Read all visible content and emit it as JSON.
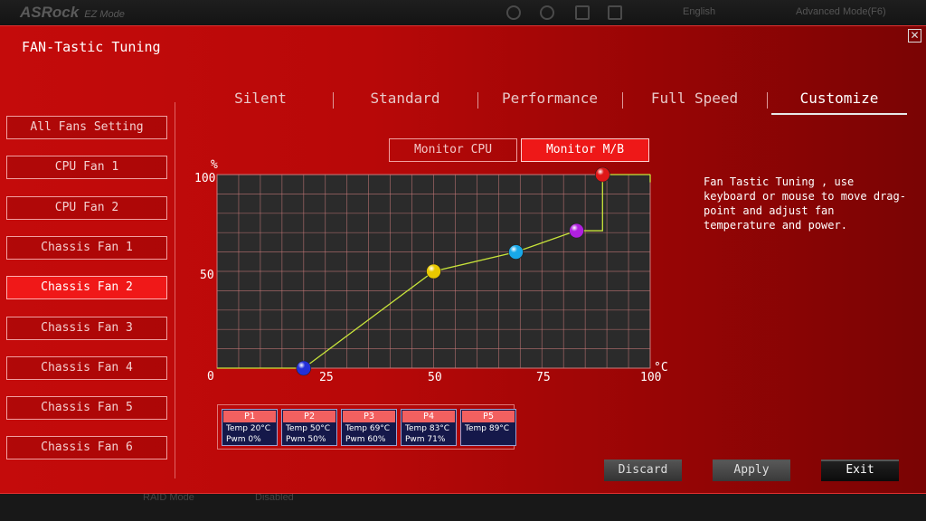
{
  "topbar": {
    "brand": "ASRock",
    "mode": "EZ Mode",
    "language": "English",
    "advanced": "Advanced Mode(F6)"
  },
  "bottombar": {
    "raid": "RAID Mode",
    "status": "Disabled"
  },
  "title": "FAN-Tastic Tuning",
  "close_icon": "close-icon",
  "fans": [
    {
      "label": "All Fans Setting",
      "active": false
    },
    {
      "label": "CPU Fan 1",
      "active": false
    },
    {
      "label": "CPU Fan 2",
      "active": false
    },
    {
      "label": "Chassis Fan 1",
      "active": false
    },
    {
      "label": "Chassis Fan 2",
      "active": true
    },
    {
      "label": "Chassis Fan 3",
      "active": false
    },
    {
      "label": "Chassis Fan 4",
      "active": false
    },
    {
      "label": "Chassis Fan 5",
      "active": false
    },
    {
      "label": "Chassis Fan 6",
      "active": false
    }
  ],
  "tabs": [
    {
      "label": "Silent",
      "active": false
    },
    {
      "label": "Standard",
      "active": false
    },
    {
      "label": "Performance",
      "active": false
    },
    {
      "label": "Full Speed",
      "active": false
    },
    {
      "label": "Customize",
      "active": true
    }
  ],
  "monitor": {
    "cpu": "Monitor CPU",
    "mb": "Monitor M/B",
    "active": "mb"
  },
  "graph": {
    "y_unit": "%",
    "x_unit": "°C",
    "y_ticks": [
      "100",
      "50",
      "0"
    ],
    "x_ticks": [
      "25",
      "50",
      "75",
      "100"
    ],
    "line_color": "#c8e43a",
    "grid_color": "#c97a7a"
  },
  "points": [
    {
      "name": "P1",
      "temp": "Temp 20°C",
      "pwm": "Pwm  0%",
      "t": 20,
      "p": 0,
      "color": "#2430d8"
    },
    {
      "name": "P2",
      "temp": "Temp 50°C",
      "pwm": "Pwm  50%",
      "t": 50,
      "p": 50,
      "color": "#e8c800"
    },
    {
      "name": "P3",
      "temp": "Temp 69°C",
      "pwm": "Pwm  60%",
      "t": 69,
      "p": 60,
      "color": "#18a8e8"
    },
    {
      "name": "P4",
      "temp": "Temp 83°C",
      "pwm": "Pwm  71%",
      "t": 83,
      "p": 71,
      "color": "#b020e0"
    },
    {
      "name": "P5",
      "temp": "Temp 89°C",
      "pwm": "",
      "t": 89,
      "p": 100,
      "color": "#e01818"
    }
  ],
  "description": "Fan Tastic Tuning , use keyboard or mouse to move drag-point and adjust fan temperature and power.",
  "buttons": {
    "discard": "Discard",
    "apply": "Apply",
    "exit": "Exit"
  }
}
